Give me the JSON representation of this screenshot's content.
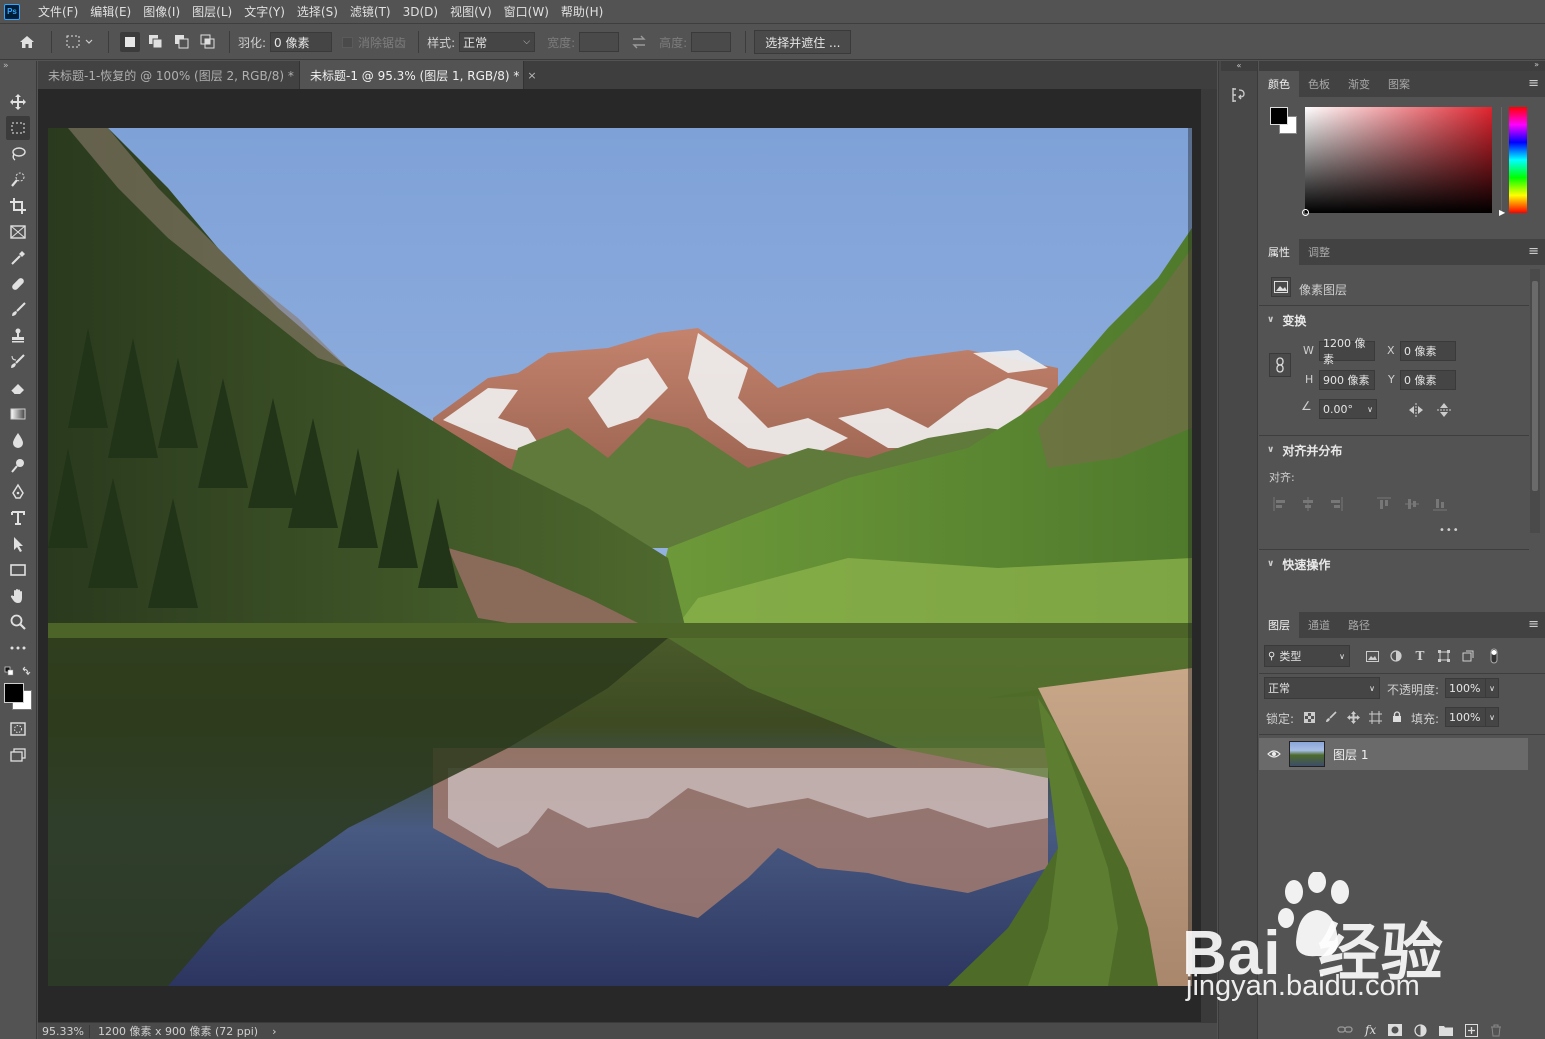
{
  "app": {
    "logo": "Ps"
  },
  "menu": [
    "文件(F)",
    "编辑(E)",
    "图像(I)",
    "图层(L)",
    "文字(Y)",
    "选择(S)",
    "滤镜(T)",
    "3D(D)",
    "视图(V)",
    "窗口(W)",
    "帮助(H)"
  ],
  "options": {
    "feather_label": "羽化:",
    "feather_value": "0 像素",
    "antialias_label": "消除锯齿",
    "style_label": "样式:",
    "style_value": "正常",
    "width_label": "宽度:",
    "height_label": "高度:",
    "select_mask_button": "选择并遮住 ..."
  },
  "tabs": [
    {
      "label": "未标题-1-恢复的 @ 100% (图层 2, RGB/8) *",
      "close": "×"
    },
    {
      "label": "未标题-1 @ 95.3% (图层 1, RGB/8) *",
      "close": "×"
    }
  ],
  "status": {
    "zoom": "95.33%",
    "doc_info": "1200 像素 x 900 像素 (72 ppi)",
    "arrow": "›"
  },
  "color_panel": {
    "tabs": [
      "颜色",
      "色板",
      "渐变",
      "图案"
    ],
    "foreground": "#000000",
    "background": "#ffffff",
    "hue_base": "#e0242f"
  },
  "properties_panel": {
    "tabs": [
      "属性",
      "调整"
    ],
    "layer_type": "像素图层",
    "transform_title": "变换",
    "w_label": "W",
    "w_value": "1200 像素",
    "h_label": "H",
    "h_value": "900 像素",
    "x_label": "X",
    "x_value": "0 像素",
    "y_label": "Y",
    "y_value": "0 像素",
    "angle_value": "0.00°",
    "align_title": "对齐并分布",
    "align_label": "对齐:",
    "more": "•••",
    "quick_title": "快速操作"
  },
  "layers_panel": {
    "tabs": [
      "图层",
      "通道",
      "路径"
    ],
    "filter_label": "类型",
    "blend_mode": "正常",
    "opacity_label": "不透明度:",
    "opacity_value": "100%",
    "lock_label": "锁定:",
    "fill_label": "填充:",
    "fill_value": "100%",
    "layers": [
      {
        "name": "图层 1",
        "visible": true
      }
    ]
  },
  "watermark": {
    "brand": "Bai  经验",
    "url": "jingyan.baidu.com"
  }
}
